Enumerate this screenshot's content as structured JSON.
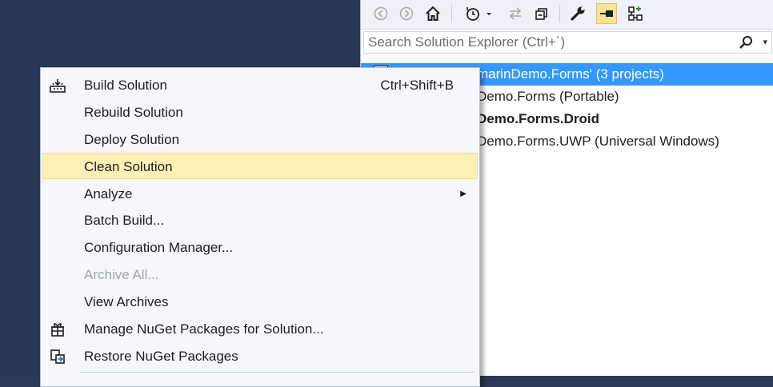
{
  "solution_explorer": {
    "search_placeholder": "Search Solution Explorer (Ctrl+`)",
    "tree": [
      {
        "text": "marinDemo.Forms' (3 projects)",
        "bold": false,
        "selected": true
      },
      {
        "text": "Demo.Forms (Portable)",
        "bold": false,
        "selected": false
      },
      {
        "text": "Demo.Forms.Droid",
        "bold": true,
        "selected": false
      },
      {
        "text": "Demo.Forms.UWP (Universal Windows)",
        "bold": false,
        "selected": false
      }
    ],
    "toolbar_icons": [
      "back-icon",
      "forward-icon",
      "home-icon",
      "history-icon",
      "sync-icon",
      "collapse-all-icon",
      "properties-icon",
      "pin-icon",
      "class-view-icon"
    ]
  },
  "context_menu": {
    "items": [
      {
        "label": "Build Solution",
        "shortcut": "Ctrl+Shift+B",
        "icon": "build-icon"
      },
      {
        "label": "Rebuild Solution"
      },
      {
        "label": "Deploy Solution"
      },
      {
        "label": "Clean Solution",
        "highlighted": true
      },
      {
        "label": "Analyze",
        "submenu": true
      },
      {
        "label": "Batch Build..."
      },
      {
        "label": "Configuration Manager..."
      },
      {
        "label": "Archive All...",
        "disabled": true
      },
      {
        "label": "View Archives"
      },
      {
        "label": "Manage NuGet Packages for Solution...",
        "icon": "nuget-icon"
      },
      {
        "label": "Restore NuGet Packages",
        "icon": "restore-icon"
      }
    ]
  },
  "colors": {
    "background": "#293955",
    "selection": "#3399ff",
    "highlight": "#fcf0b4"
  }
}
